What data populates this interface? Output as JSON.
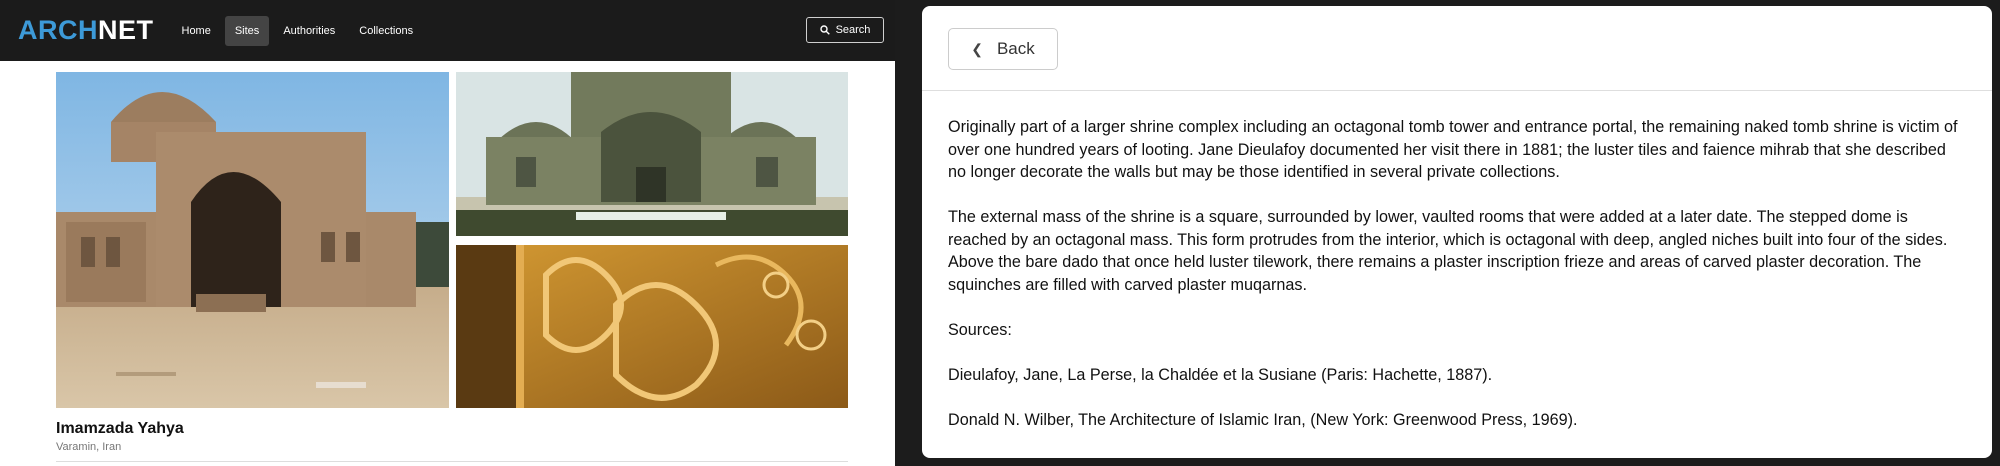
{
  "nav": {
    "logo_part1": "ARCH",
    "logo_part2": "NET",
    "links": [
      "Home",
      "Sites",
      "Authorities",
      "Collections"
    ],
    "active_link": "Sites",
    "search_label": "Search"
  },
  "site": {
    "title": "Imamzada Yahya",
    "location": "Varamin, Iran"
  },
  "detail": {
    "back_label": "Back",
    "paragraphs": [
      "Originally part of a larger shrine complex including an octagonal tomb tower and entrance portal, the remaining naked tomb shrine is victim of over one hundred years of looting. Jane Dieulafoy documented her visit there in 1881; the luster tiles and faience mihrab that she described no longer decorate the walls but may be those identified in several private collections.",
      "The external mass of the shrine is a square, surrounded by lower, vaulted rooms that were added at a later date. The stepped dome is reached by an octagonal mass. This form protrudes from the interior, which is octagonal with deep, angled niches built into four of the sides. Above the bare dado that once held luster tilework, there remains a plaster inscription frieze and areas of carved plaster decoration. The squinches are filled with carved plaster muqarnas.",
      "Sources:",
      "Dieulafoy, Jane, La Perse, la Chaldée et la Susiane (Paris: Hachette, 1887).",
      "Donald N. Wilber, The Architecture of Islamic Iran, (New York: Greenwood Press, 1969)."
    ]
  },
  "colors": {
    "navbar_bg": "#1b1b1b",
    "logo_accent": "#3d9ad8",
    "page_bg": "#1c1c1c"
  },
  "icons": {
    "search": "search-icon",
    "back": "chevron-left-icon"
  }
}
